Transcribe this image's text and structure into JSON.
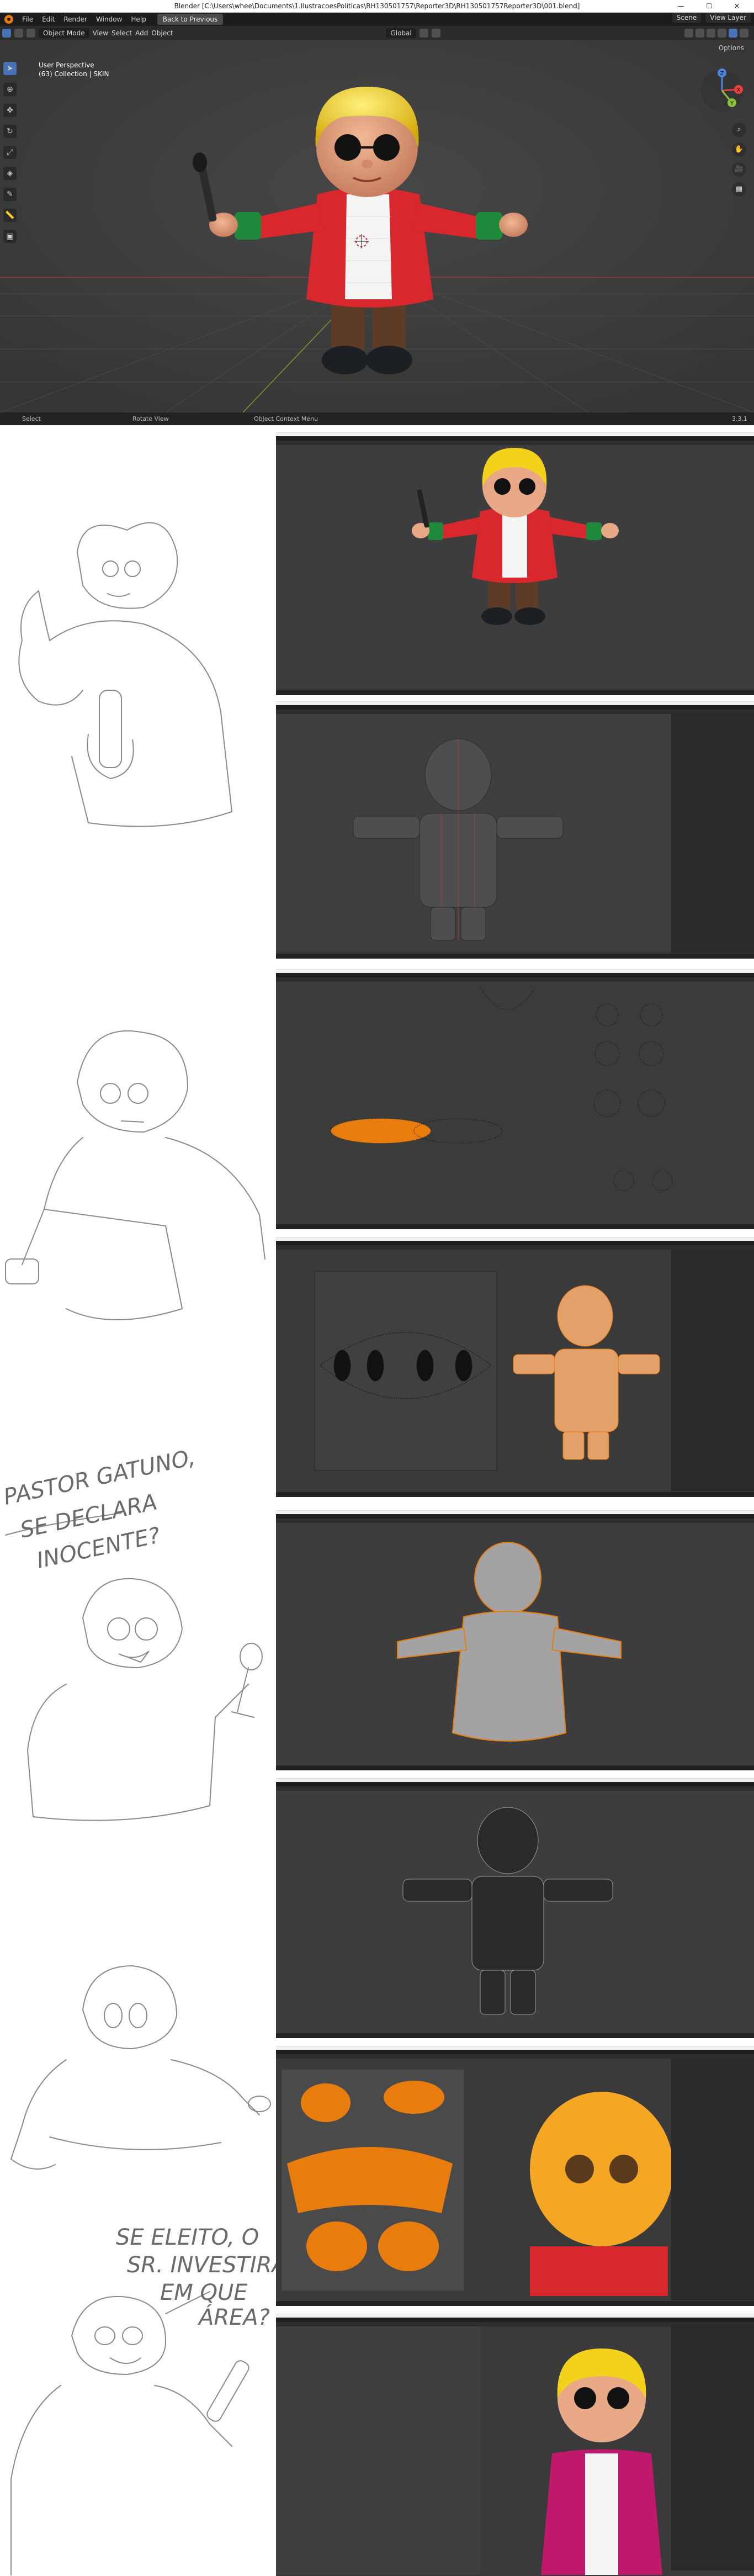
{
  "window": {
    "title": "Blender [C:\\Users\\whee\\Documents\\1.IlustracoesPoliticas\\RH130501757\\Reporter3D\\RH130501757Reporter3D\\001.blend]",
    "controls": "— ☐ ✕"
  },
  "menubar": {
    "items": [
      "File",
      "Edit",
      "Render",
      "Window",
      "Help"
    ],
    "back_button": "Back to Previous",
    "scene": "Scene",
    "view_layer": "View Layer"
  },
  "header": {
    "mode": "Object Mode",
    "menus": [
      "View",
      "Select",
      "Add",
      "Object"
    ],
    "orientation": "Global",
    "options": "Options"
  },
  "viewport": {
    "info_line1": "User Perspective",
    "info_line2": "(63) Collection | SKIN",
    "gizmo_axes": [
      "X",
      "Y",
      "Z"
    ]
  },
  "statusbar": {
    "select": "Select",
    "rotate": "Rotate View",
    "context": "Object Context Menu",
    "version": "3.3.1"
  },
  "sketch_text": {
    "caption1_line1": "PASTOR GATUNO,",
    "caption1_line2": "SE DECLARA",
    "caption1_line3": "INOCENTE?",
    "caption2_line1": "SE ELEITO, O",
    "caption2_line2": "SR. INVESTIRÁ",
    "caption2_line3": "EM QUE",
    "caption2_line4": "ÁREA?"
  },
  "colors": {
    "accent": "#4772b3",
    "selection": "#e87d0d",
    "jacket": "#d9272e",
    "hair": "#f3d21b",
    "sleeve": "#1f8a3b"
  }
}
